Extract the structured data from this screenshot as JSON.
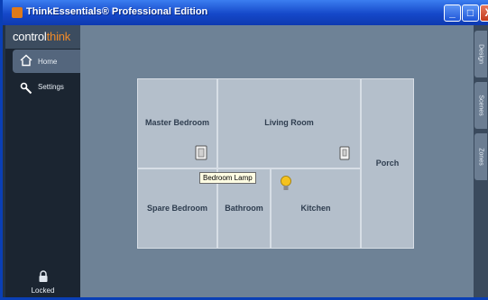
{
  "window": {
    "title": "ThinkEssentials® Professional Edition",
    "buttons": {
      "minimize": "_",
      "maximize": "□",
      "close": "X"
    }
  },
  "logo": {
    "part1": "control",
    "part2": "think"
  },
  "nav": {
    "home": {
      "label": "Home",
      "icon": "house-icon"
    },
    "settings": {
      "label": "Settings",
      "icon": "wrench-icon"
    },
    "locked": {
      "label": "Locked",
      "icon": "lock-icon"
    }
  },
  "rooms": {
    "master_bedroom": "Master Bedroom",
    "living_room": "Living Room",
    "porch": "Porch",
    "spare_bedroom": "Spare Bedroom",
    "bathroom": "Bathroom",
    "kitchen": "Kitchen"
  },
  "devices": {
    "bedroom_lamp": {
      "label": "Bedroom Lamp",
      "icon": "lamp-switch-icon"
    },
    "living_switch": {
      "icon": "light-switch-icon"
    },
    "kitchen_bulb": {
      "icon": "lightbulb-icon"
    }
  },
  "side_tabs": [
    "Design",
    "Scenes",
    "Zones"
  ],
  "colors": {
    "accent": "#f08a28",
    "titlebar": "#1548c9",
    "room": "#b4bfcb"
  }
}
